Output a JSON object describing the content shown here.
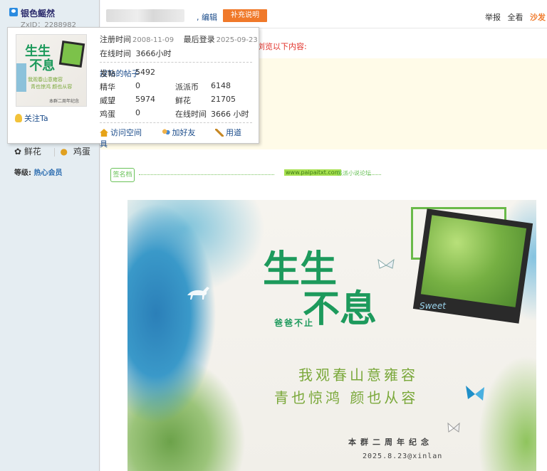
{
  "user": {
    "name": "银色鳐然",
    "zxid": "ZxID：2288982",
    "level_label": "等级:",
    "level_value": "热心会员"
  },
  "left_actions": {
    "flower": "鲜花",
    "egg": "鸡蛋"
  },
  "topbar": {
    "edit": ", 编辑",
    "supplement": "补充说明",
    "report": "举报",
    "view_all": "全看",
    "sofa": "沙发"
  },
  "notice": "浏览以下内容:",
  "popup": {
    "follow": "关注Ta",
    "register_label": "注册时间",
    "register_value": "2008-11-09",
    "last_login_label": "最后登录",
    "last_login_value": "2025-09-23",
    "online_label": "在线时间",
    "online_value": "3666小时",
    "stats": [
      {
        "k1": "发帖",
        "v1": "5492",
        "k2": "搜Ta的帖子",
        "v2": ""
      },
      {
        "k1": "精华",
        "v1": "0",
        "k2": "派派币",
        "v2": "6148"
      },
      {
        "k1": "威望",
        "v1": "5974",
        "k2": "鲜花",
        "v2": "21705"
      },
      {
        "k1": "鸡蛋",
        "v1": "0",
        "k2": "在线时间",
        "v2": "3666 小时"
      }
    ],
    "actions": {
      "visit": "访问空间",
      "add_friend": "加好友",
      "use_tool": "用道具"
    }
  },
  "signature": {
    "badge": "签名档",
    "url": "www.paipaitxt.com",
    "note": "派派小说论坛"
  },
  "poster": {
    "title_line1": "生生",
    "title_line2": "不息",
    "subtitle": "爸爸不止",
    "poem1": "我观春山意雍容",
    "poem2": "青也惊鸿  颜也从容",
    "anniversary": "本群二周年纪念",
    "date": "2025.8.23@xinlan",
    "sweet": "Sweet"
  }
}
